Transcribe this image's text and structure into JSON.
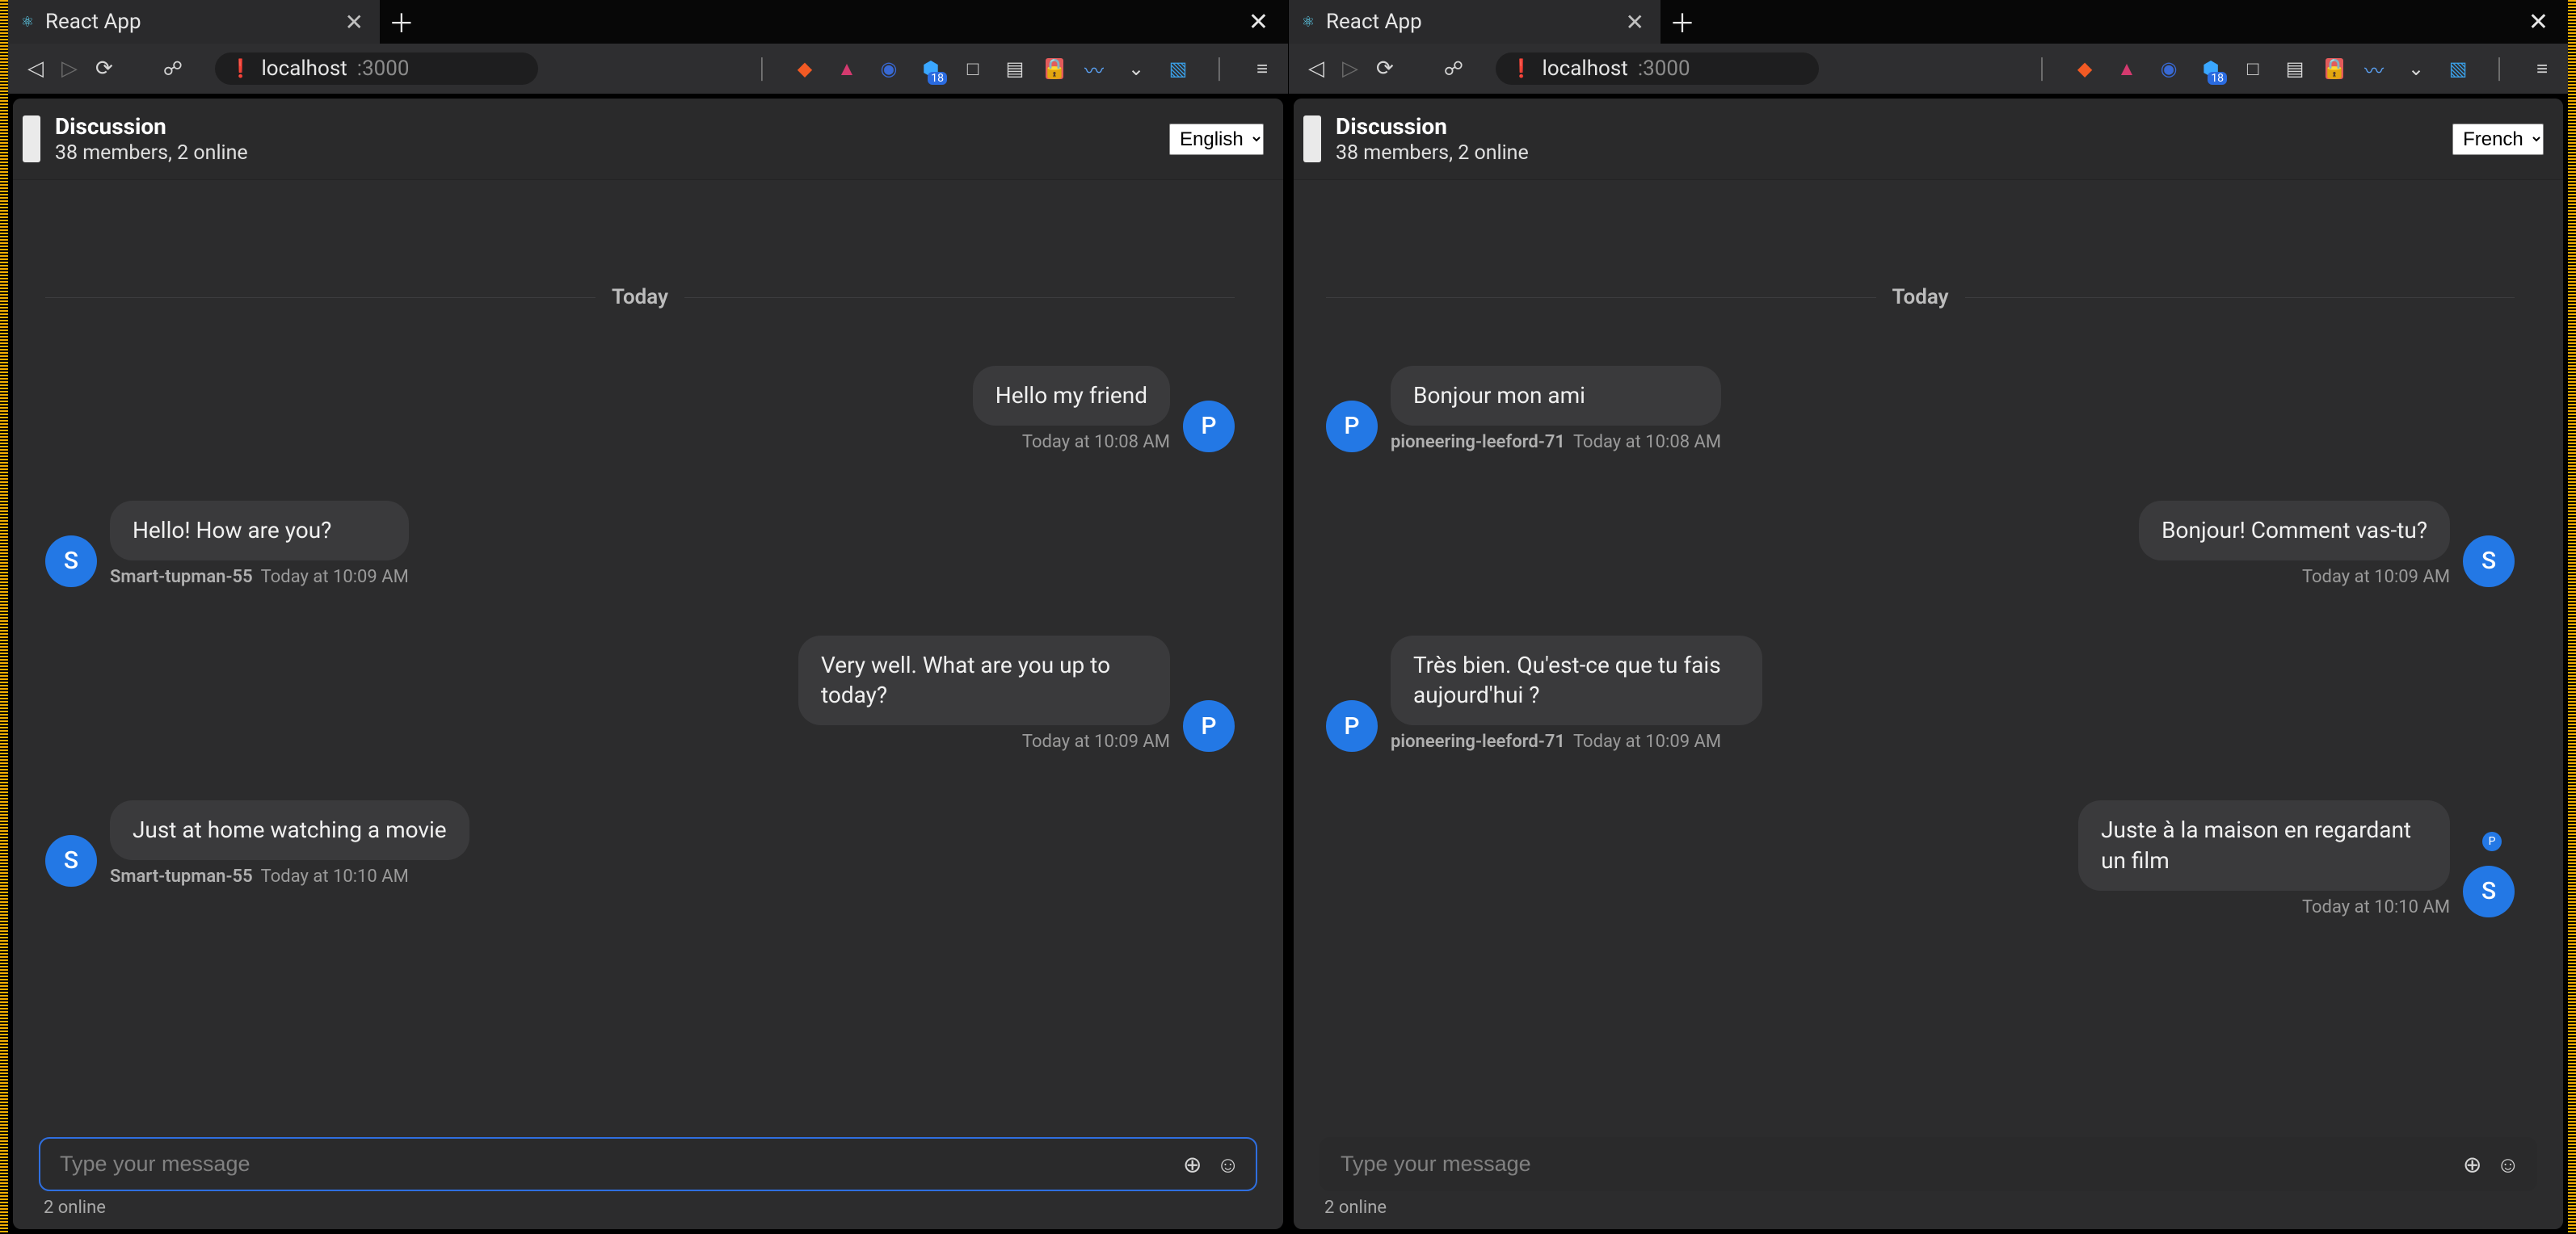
{
  "left": {
    "tab_title": "React App",
    "url": {
      "host": "localhost",
      "port": ":3000"
    },
    "badge_count": "18",
    "header": {
      "title": "Discussion",
      "subtitle": "38 members, 2 online"
    },
    "language": "English",
    "divider_label": "Today",
    "messages": [
      {
        "side": "right",
        "avatar": "P",
        "text": "Hello my friend",
        "author": "",
        "time": "Today at 10:08 AM"
      },
      {
        "side": "left",
        "avatar": "S",
        "text": "Hello! How are you?",
        "author": "Smart-tupman-55",
        "time": "Today at 10:09 AM"
      },
      {
        "side": "right",
        "avatar": "P",
        "text": "Very well. What are you up to today?",
        "author": "",
        "time": "Today at 10:09 AM"
      },
      {
        "side": "left",
        "avatar": "S",
        "text": "Just at home watching a movie",
        "author": "Smart-tupman-55",
        "time": "Today at 10:10 AM"
      }
    ],
    "input_placeholder": "Type your message",
    "input_focused": true,
    "footer_online": "2 online"
  },
  "right": {
    "tab_title": "React App",
    "url": {
      "host": "localhost",
      "port": ":3000"
    },
    "badge_count": "18",
    "header": {
      "title": "Discussion",
      "subtitle": "38 members, 2 online"
    },
    "language": "French",
    "divider_label": "Today",
    "messages": [
      {
        "side": "left",
        "avatar": "P",
        "text": "Bonjour mon ami",
        "author": "pioneering-leeford-71",
        "time": "Today at 10:08 AM"
      },
      {
        "side": "right",
        "avatar": "S",
        "text": "Bonjour! Comment vas-tu?",
        "author": "",
        "time": "Today at 10:09 AM"
      },
      {
        "side": "left",
        "avatar": "P",
        "text": "Très bien. Qu'est-ce que tu fais aujourd'hui ?",
        "author": "pioneering-leeford-71",
        "time": "Today at 10:09 AM"
      },
      {
        "side": "right",
        "avatar": "S",
        "aux_avatar": "P",
        "text": "Juste à la maison en regardant un film",
        "author": "",
        "time": "Today at 10:10 AM"
      }
    ],
    "input_placeholder": "Type your message",
    "input_focused": false,
    "footer_online": "2 online"
  }
}
